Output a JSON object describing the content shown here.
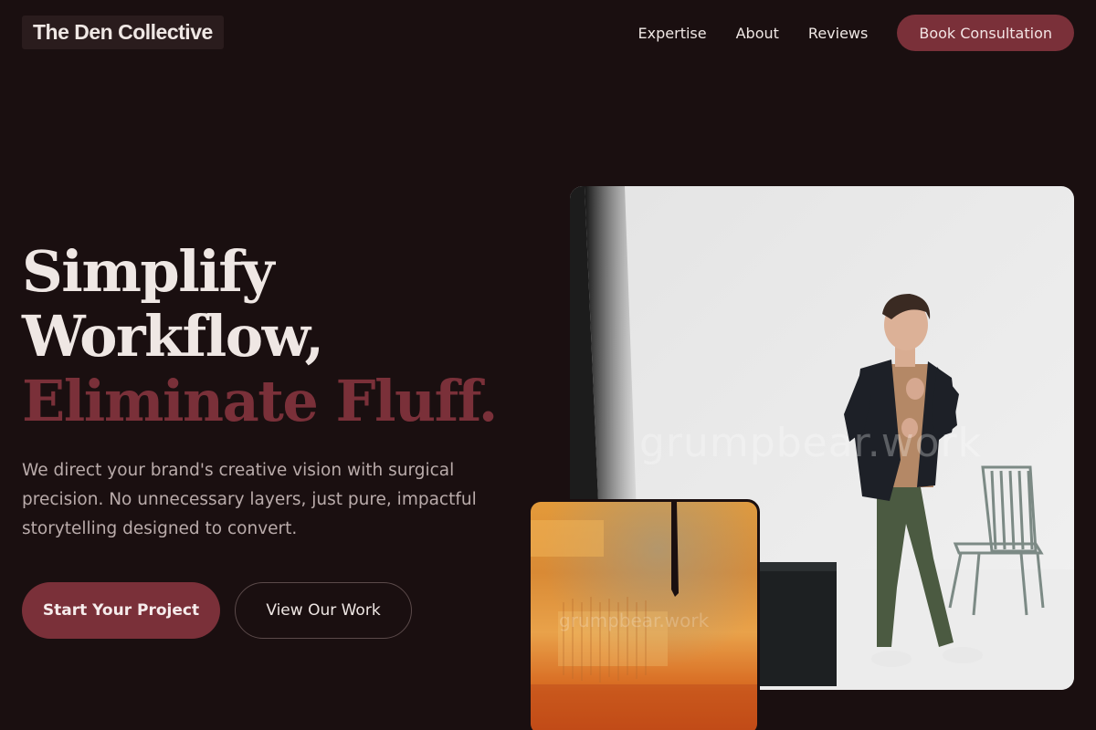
{
  "brand": {
    "name": "The Den Collective",
    "accent_color": "#7a3039",
    "background_color": "#1a0f10"
  },
  "nav": {
    "links": [
      "Expertise",
      "About",
      "Reviews"
    ],
    "cta_label": "Book Consultation"
  },
  "hero": {
    "title_line_1": "Simplify",
    "title_line_2": "Workflow,",
    "title_line_3": "Eliminate Fluff.",
    "subtitle": "We direct your brand's creative vision with surgical precision. No unnecessary layers, just pure, impactful storytelling designed to convert.",
    "primary_button": "Start Your Project",
    "secondary_button": "View Our Work"
  },
  "images": {
    "main_photo_icon": "man-in-studio-photo",
    "art_card_icon": "orange-abstract-painting",
    "watermark_text": "grumpbear.work",
    "art_watermark_text": "grumpbear.work"
  }
}
